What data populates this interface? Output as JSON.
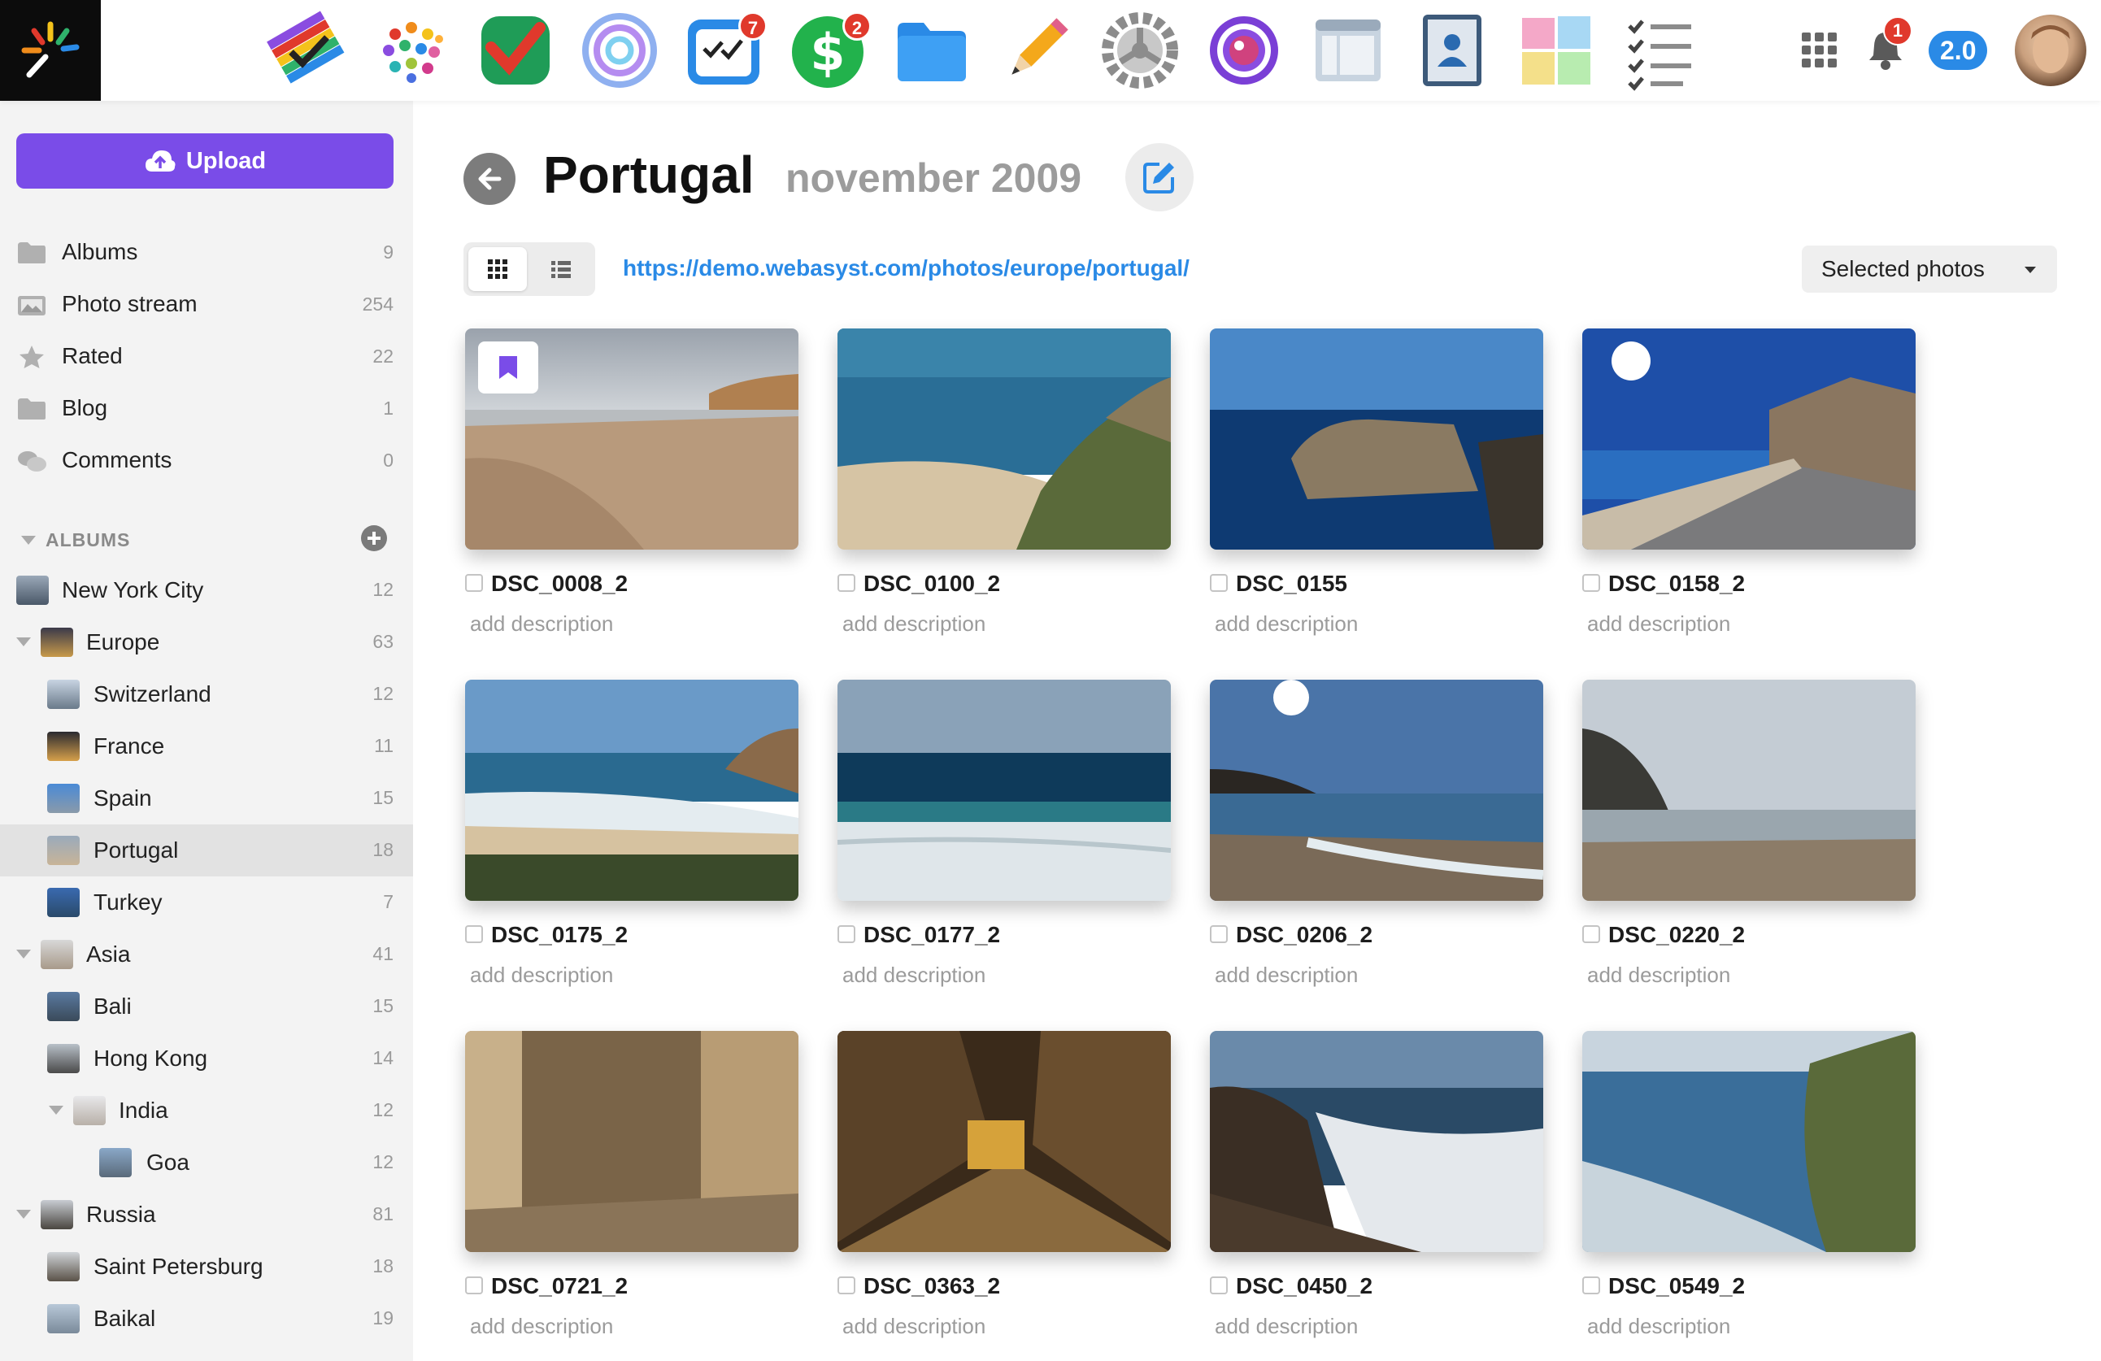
{
  "topbar": {
    "apps": [
      {
        "name": "Shop-Script",
        "icon": "shop-icon"
      },
      {
        "name": "Site",
        "icon": "site-icon"
      },
      {
        "name": "CRM",
        "icon": "crm-icon"
      },
      {
        "name": "Hub",
        "icon": "hub-icon"
      },
      {
        "name": "Team",
        "icon": "team-icon",
        "badge": "7"
      },
      {
        "name": "Cash Flow",
        "icon": "cash-icon",
        "badge": "2"
      },
      {
        "name": "Files",
        "icon": "files-icon"
      },
      {
        "name": "Blog",
        "icon": "blog-icon"
      },
      {
        "name": "Installer",
        "icon": "installer-icon"
      },
      {
        "name": "Photos",
        "icon": "photos-icon"
      },
      {
        "name": "Site Editor",
        "icon": "window-icon"
      },
      {
        "name": "Contacts",
        "icon": "contacts-icon"
      },
      {
        "name": "Notes",
        "icon": "stickies-icon"
      },
      {
        "name": "Tasks",
        "icon": "checklists-icon"
      }
    ],
    "notifications_badge": "1",
    "version": "2.0"
  },
  "sidebar": {
    "upload_label": "Upload",
    "nav": [
      {
        "label": "Albums",
        "count": "9",
        "icon": "folder-icon"
      },
      {
        "label": "Photo stream",
        "count": "254",
        "icon": "images-icon"
      },
      {
        "label": "Rated",
        "count": "22",
        "icon": "star-icon"
      },
      {
        "label": "Blog",
        "count": "1",
        "icon": "folder-icon"
      },
      {
        "label": "Comments",
        "count": "0",
        "icon": "comments-icon"
      }
    ],
    "albums_heading": "ALBUMS",
    "albums": [
      {
        "label": "New York City",
        "count": "12"
      },
      {
        "label": "Europe",
        "count": "63"
      },
      {
        "label": "Switzerland",
        "count": "12"
      },
      {
        "label": "France",
        "count": "11"
      },
      {
        "label": "Spain",
        "count": "15"
      },
      {
        "label": "Portugal",
        "count": "18",
        "active": true
      },
      {
        "label": "Turkey",
        "count": "7"
      },
      {
        "label": "Asia",
        "count": "41"
      },
      {
        "label": "Bali",
        "count": "15"
      },
      {
        "label": "Hong Kong",
        "count": "14"
      },
      {
        "label": "India",
        "count": "12"
      },
      {
        "label": "Goa",
        "count": "12"
      },
      {
        "label": "Russia",
        "count": "81"
      },
      {
        "label": "Saint Petersburg",
        "count": "18"
      },
      {
        "label": "Baikal",
        "count": "19"
      }
    ]
  },
  "main": {
    "title": "Portugal",
    "date": "november 2009",
    "url": "https://demo.webasyst.com/photos/europe/portugal/",
    "selected_label": "Selected photos",
    "photos": [
      {
        "name": "DSC_0008_2",
        "description": "add description",
        "favorite": true
      },
      {
        "name": "DSC_0100_2",
        "description": "add description"
      },
      {
        "name": "DSC_0155",
        "description": "add description"
      },
      {
        "name": "DSC_0158_2",
        "description": "add description"
      },
      {
        "name": "DSC_0175_2",
        "description": "add description"
      },
      {
        "name": "DSC_0177_2",
        "description": "add description"
      },
      {
        "name": "DSC_0206_2",
        "description": "add description"
      },
      {
        "name": "DSC_0220_2",
        "description": "add description"
      },
      {
        "name": "DSC_0721_2",
        "description": "add description"
      },
      {
        "name": "DSC_0363_2",
        "description": "add description"
      },
      {
        "name": "DSC_0450_2",
        "description": "add description"
      },
      {
        "name": "DSC_0549_2",
        "description": "add description"
      }
    ]
  },
  "colors": {
    "accent": "#7a4ce8",
    "link": "#2a8ae6",
    "badge": "#e0392c",
    "sidebar_bg": "#f3f3f3",
    "active_item": "#e2e2e2"
  }
}
